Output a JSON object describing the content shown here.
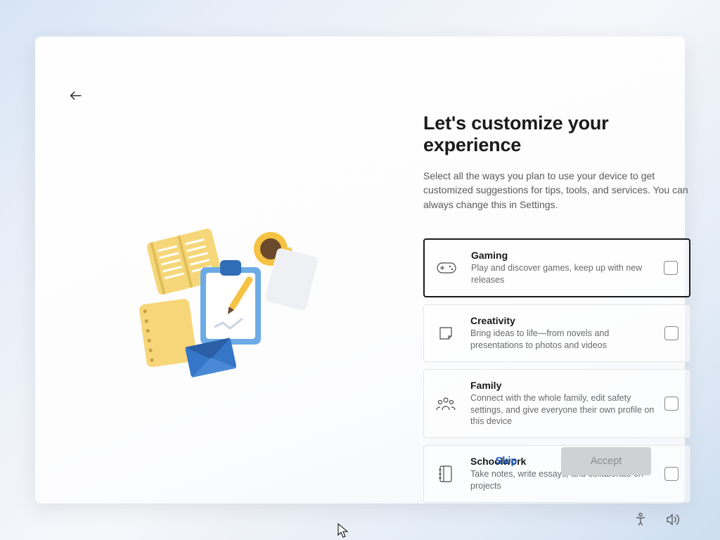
{
  "title": "Let's customize your experience",
  "subtitle": "Select all the ways you plan to use your device to get customized suggestions for tips, tools, and services. You can always change this in Settings.",
  "options": [
    {
      "title": "Gaming",
      "desc": "Play and discover games, keep up with new releases",
      "selected": true
    },
    {
      "title": "Creativity",
      "desc": "Bring ideas to life—from novels and presentations to photos and videos",
      "selected": false
    },
    {
      "title": "Family",
      "desc": "Connect with the whole family, edit safety settings, and give everyone their own profile on this device",
      "selected": false
    },
    {
      "title": "Schoolwork",
      "desc": "Take notes, write essays, and collaborate on projects",
      "selected": false
    }
  ],
  "buttons": {
    "skip": "Skip",
    "accept": "Accept"
  }
}
